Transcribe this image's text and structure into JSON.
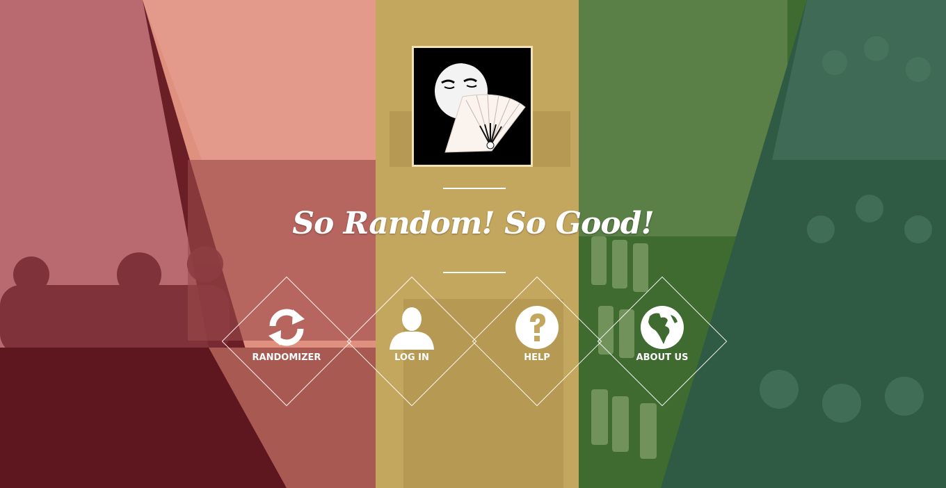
{
  "hero": {
    "tagline": "So Random!  So Good!"
  },
  "nav": {
    "items": [
      {
        "label": "RANDOMIZER",
        "icon": "refresh-icon"
      },
      {
        "label": "LOG IN",
        "icon": "user-icon"
      },
      {
        "label": "HELP",
        "icon": "question-circle-icon"
      },
      {
        "label": "ABOUT US",
        "icon": "globe-icon"
      }
    ]
  },
  "colors": {
    "maroon": "#5a1a22",
    "rose": "#b86a70",
    "salmon": "#e3978a",
    "mustard": "#c4a75e",
    "olive_green": "#5a7a45",
    "teal_green": "#2f5b45",
    "logo_border": "#f3e2b4",
    "white": "#ffffff"
  }
}
